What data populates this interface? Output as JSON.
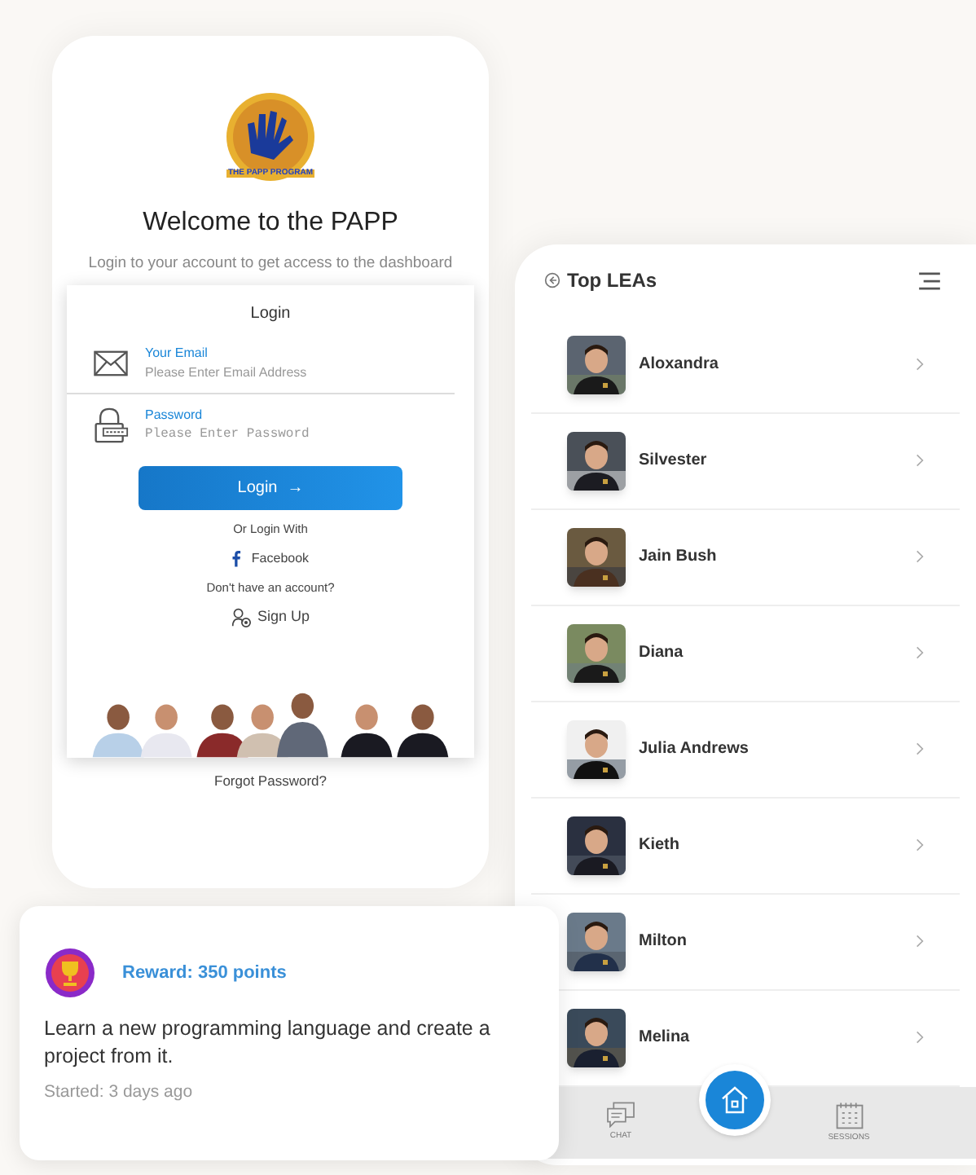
{
  "login_screen": {
    "logo_text": "THE PAPP PROGRAM",
    "title": "Welcome to the PAPP",
    "subtitle": "Login to your account to get access to the dashboard",
    "form": {
      "heading": "Login",
      "fields": [
        {
          "kind": "email",
          "label": "Your Email",
          "placeholder": "Please Enter Email Address"
        },
        {
          "kind": "password",
          "label": "Password",
          "placeholder": "Please Enter Password"
        }
      ],
      "login_button": "Login",
      "login_arrow": "→",
      "alt_text": "Or Login With",
      "facebook_link": "Facebook",
      "signup_prompt": "Don't have an account?",
      "signup_link": "Sign Up"
    },
    "forgot_link": "Forgot Password?"
  },
  "leas_screen": {
    "title": "Top LEAs",
    "items": [
      {
        "name": "Aloxandra"
      },
      {
        "name": "Silvester"
      },
      {
        "name": "Jain Bush"
      },
      {
        "name": "Diana"
      },
      {
        "name": "Julia Andrews"
      },
      {
        "name": "Kieth"
      },
      {
        "name": "Milton"
      },
      {
        "name": "Melina"
      }
    ],
    "nav": [
      {
        "kind": "chat",
        "label": "CHAT"
      },
      {
        "kind": "home"
      },
      {
        "kind": "sessions",
        "label": "SESSIONS"
      }
    ]
  },
  "reward_card": {
    "reward": "Reward: 350 points",
    "task": "Learn a new programming language and create a project from it.",
    "started": "Started: 3 days ago"
  }
}
